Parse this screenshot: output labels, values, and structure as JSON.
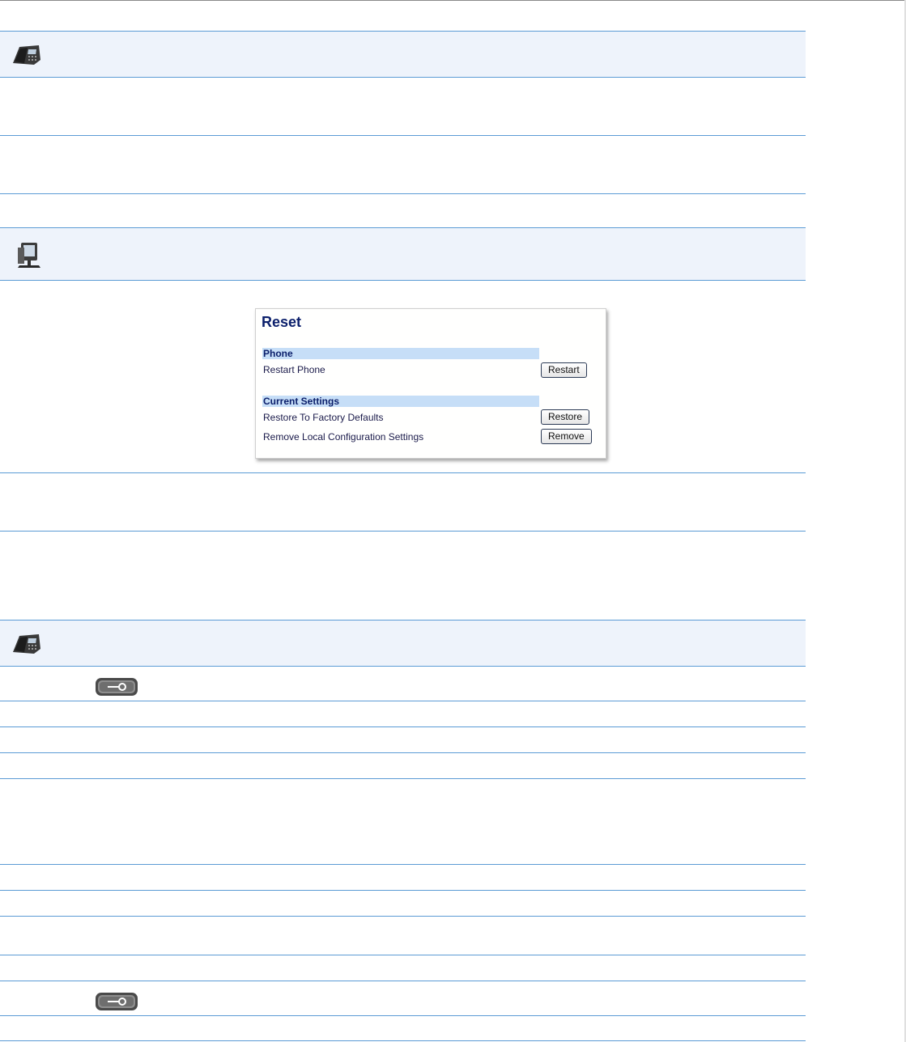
{
  "icons": {
    "phone_ui_1": "ip-phone-icon",
    "web_ui": "computer-icon",
    "phone_ui_2": "ip-phone-icon",
    "options_key_1": "options-key-icon",
    "options_key_2": "options-key-icon"
  },
  "colors": {
    "band_background": "#eef3fb",
    "rule": "#5b9bd5",
    "section_header": "#c6def7",
    "title_text": "#0b1f6b"
  },
  "reset_panel": {
    "title": "Reset",
    "sections": [
      {
        "header": "Phone",
        "rows": [
          {
            "label": "Restart Phone",
            "button": "Restart"
          }
        ]
      },
      {
        "header": "Current Settings",
        "rows": [
          {
            "label": "Restore To Factory Defaults",
            "button": "Restore"
          },
          {
            "label": "Remove Local Configuration Settings",
            "button": "Remove"
          }
        ]
      }
    ]
  }
}
